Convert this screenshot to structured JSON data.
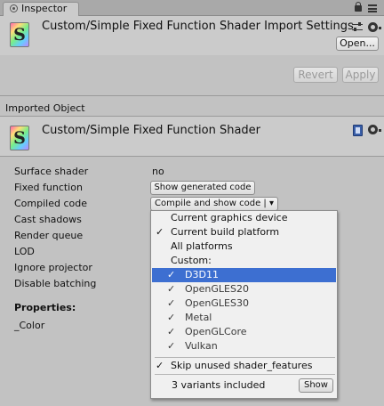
{
  "tab": {
    "label": "Inspector"
  },
  "importer": {
    "title": "Custom/Simple Fixed Function Shader Import Settings",
    "open_label": "Open...",
    "revert_label": "Revert",
    "apply_label": "Apply"
  },
  "imported": {
    "section_label": "Imported Object",
    "title": "Custom/Simple Fixed Function Shader"
  },
  "properties": [
    {
      "label": "Surface shader",
      "value": "no"
    },
    {
      "label": "Fixed function",
      "button": "Show generated code"
    },
    {
      "label": "Compiled code",
      "button": "Compile and show code | ▾"
    },
    {
      "label": "Cast shadows"
    },
    {
      "label": "Render queue"
    },
    {
      "label": "LOD"
    },
    {
      "label": "Ignore projector"
    },
    {
      "label": "Disable batching"
    }
  ],
  "props_section": {
    "heading": "Properties:",
    "items": [
      "_Color"
    ]
  },
  "dropdown": {
    "items": [
      {
        "label": "Current graphics device",
        "checked": false
      },
      {
        "label": "Current build platform",
        "checked": true
      },
      {
        "label": "All platforms",
        "checked": false
      },
      {
        "label": "Custom:",
        "checked": false
      }
    ],
    "platforms": [
      {
        "label": "D3D11",
        "checked": true,
        "selected": true
      },
      {
        "label": "OpenGLES20",
        "checked": true
      },
      {
        "label": "OpenGLES30",
        "checked": true
      },
      {
        "label": "Metal",
        "checked": true
      },
      {
        "label": "OpenGLCore",
        "checked": true
      },
      {
        "label": "Vulkan",
        "checked": true
      }
    ],
    "skip_label": "Skip unused shader_features",
    "skip_checked": true,
    "variants_label": "3 variants included",
    "show_label": "Show",
    "check_glyph": "✓"
  },
  "colors": {
    "selection": "#3d6fd1",
    "panel": "#c2c2c2",
    "header": "#cbcbcb"
  }
}
